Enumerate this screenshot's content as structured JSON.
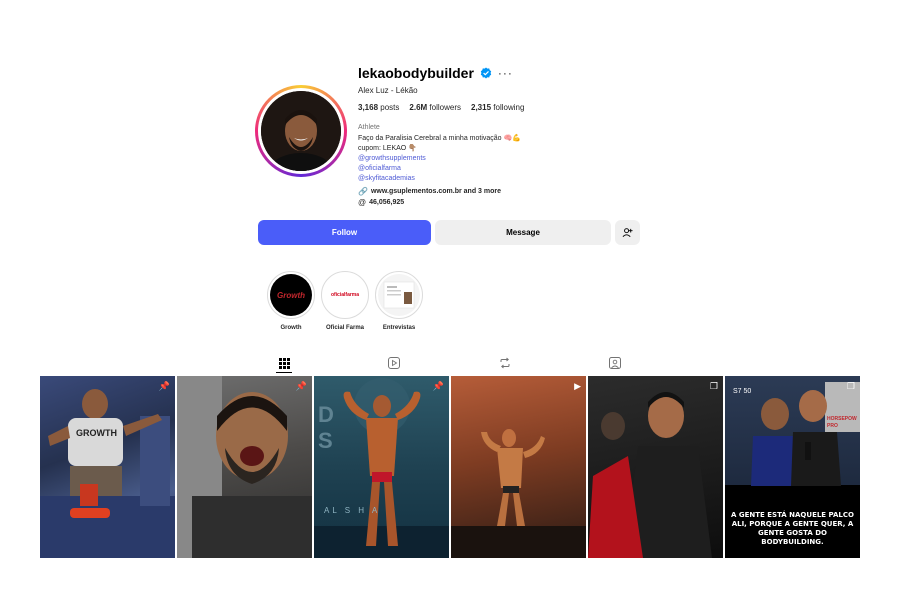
{
  "profile": {
    "username": "lekaobodybuilder",
    "full_name": "Alex Luz - Lékão",
    "stats": {
      "posts_value": "3,168",
      "posts_label": "posts",
      "followers_value": "2.6M",
      "followers_label": "followers",
      "following_value": "2,315",
      "following_label": "following"
    },
    "category": "Athlete",
    "bio_line1": "Faço da Paralisia Cerebral a minha motivação 🧠💪",
    "bio_line2": "cupom: LEKAO 👇🏽",
    "mentions": [
      "@growthsupplements",
      "@oficialfarma",
      "@skyfitacademias"
    ],
    "external_link": "www.gsuplementos.com.br and 3 more",
    "threads_count": "46,056,925"
  },
  "actions": {
    "follow": "Follow",
    "message": "Message"
  },
  "highlights": [
    {
      "label": "Growth",
      "logo_text": "Growth",
      "color": "#c1272d"
    },
    {
      "label": "Oficial Farma",
      "logo_text": "oficialfarma",
      "color": "#d0021b"
    },
    {
      "label": "Entrevistas"
    }
  ],
  "tabs": [
    "posts-grid",
    "reels",
    "reposts",
    "tagged"
  ],
  "grid": [
    {
      "badge": "pin",
      "shirt_text": "GROWTH"
    },
    {
      "badge": "pin"
    },
    {
      "badge": "pin",
      "bg_text": "D  S",
      "bottom_text": "AL  S  H  A"
    },
    {
      "badge": "reel"
    },
    {
      "badge": "carousel"
    },
    {
      "badge": "carousel",
      "top_text": "S7 50",
      "side_text": "HORSEPOW PRO",
      "overlay": "A GENTE ESTÁ NAQUELE PALCO ALI, PORQUE A GENTE QUER, A GENTE GOSTA DO BODYBUILDING."
    }
  ],
  "colors": {
    "accent": "#4a5df9",
    "link": "#4f5bd5",
    "verified": "#0095f6"
  }
}
